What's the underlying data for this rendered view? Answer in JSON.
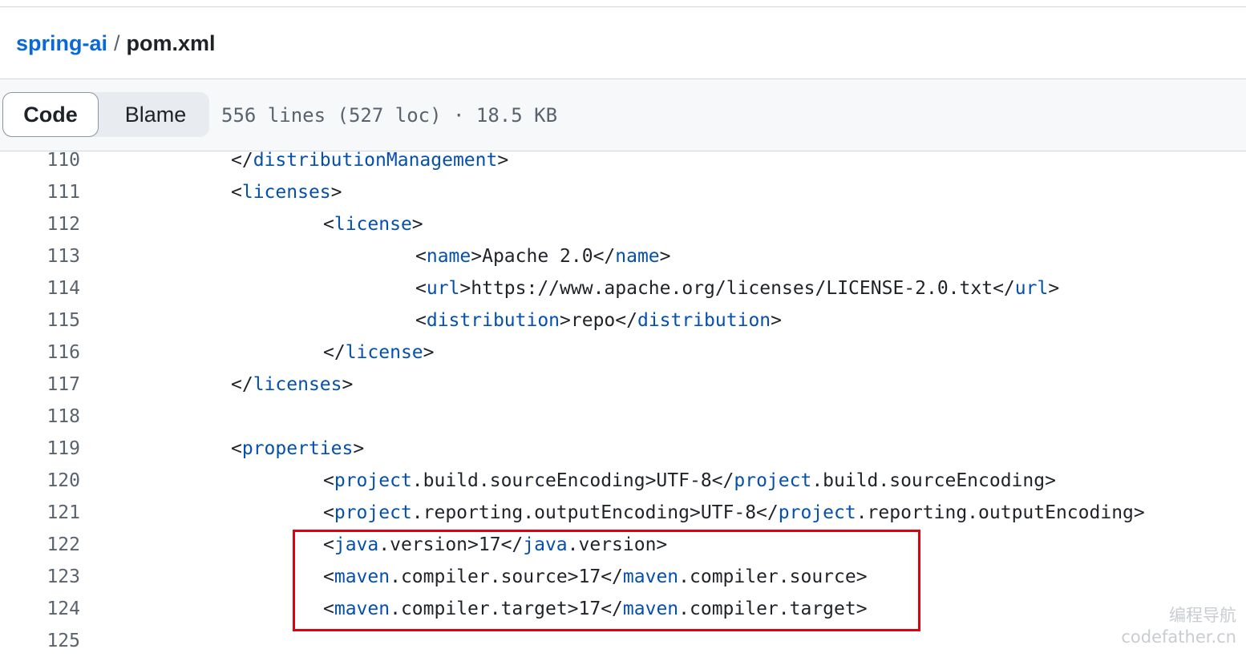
{
  "breadcrumb": {
    "repo": "spring-ai",
    "separator": "/",
    "file": "pom.xml"
  },
  "toolbar": {
    "code_label": "Code",
    "blame_label": "Blame",
    "file_info": "556 lines (527 loc) · 18.5 KB"
  },
  "code": {
    "lines": [
      {
        "num": "110",
        "indent": 0,
        "tokens": [
          {
            "t": "</"
          },
          {
            "t": "distributionManagement",
            "tag": true
          },
          {
            "t": ">"
          }
        ]
      },
      {
        "num": "111",
        "indent": 0,
        "tokens": [
          {
            "t": "<"
          },
          {
            "t": "licenses",
            "tag": true
          },
          {
            "t": ">"
          }
        ]
      },
      {
        "num": "112",
        "indent": 1,
        "tokens": [
          {
            "t": "<"
          },
          {
            "t": "license",
            "tag": true
          },
          {
            "t": ">"
          }
        ]
      },
      {
        "num": "113",
        "indent": 2,
        "tokens": [
          {
            "t": "<"
          },
          {
            "t": "name",
            "tag": true
          },
          {
            "t": ">Apache 2.0</"
          },
          {
            "t": "name",
            "tag": true
          },
          {
            "t": ">"
          }
        ]
      },
      {
        "num": "114",
        "indent": 2,
        "tokens": [
          {
            "t": "<"
          },
          {
            "t": "url",
            "tag": true
          },
          {
            "t": ">https://www.apache.org/licenses/LICENSE-2.0.txt</"
          },
          {
            "t": "url",
            "tag": true
          },
          {
            "t": ">"
          }
        ]
      },
      {
        "num": "115",
        "indent": 2,
        "tokens": [
          {
            "t": "<"
          },
          {
            "t": "distribution",
            "tag": true
          },
          {
            "t": ">repo</"
          },
          {
            "t": "distribution",
            "tag": true
          },
          {
            "t": ">"
          }
        ]
      },
      {
        "num": "116",
        "indent": 1,
        "tokens": [
          {
            "t": "</"
          },
          {
            "t": "license",
            "tag": true
          },
          {
            "t": ">"
          }
        ]
      },
      {
        "num": "117",
        "indent": 0,
        "tokens": [
          {
            "t": "</"
          },
          {
            "t": "licenses",
            "tag": true
          },
          {
            "t": ">"
          }
        ]
      },
      {
        "num": "118",
        "indent": 0,
        "tokens": []
      },
      {
        "num": "119",
        "indent": 0,
        "tokens": [
          {
            "t": "<"
          },
          {
            "t": "properties",
            "tag": true
          },
          {
            "t": ">"
          }
        ]
      },
      {
        "num": "120",
        "indent": 1,
        "tokens": [
          {
            "t": "<"
          },
          {
            "t": "project",
            "tag": true
          },
          {
            "t": ".build.sourceEncoding>UTF-8</"
          },
          {
            "t": "project",
            "tag": true
          },
          {
            "t": ".build.sourceEncoding>"
          }
        ]
      },
      {
        "num": "121",
        "indent": 1,
        "tokens": [
          {
            "t": "<"
          },
          {
            "t": "project",
            "tag": true
          },
          {
            "t": ".reporting.outputEncoding>UTF-8</"
          },
          {
            "t": "project",
            "tag": true
          },
          {
            "t": ".reporting.outputEncoding>"
          }
        ]
      },
      {
        "num": "122",
        "indent": 1,
        "tokens": [
          {
            "t": "<"
          },
          {
            "t": "java",
            "tag": true
          },
          {
            "t": ".version>17</"
          },
          {
            "t": "java",
            "tag": true
          },
          {
            "t": ".version>"
          }
        ]
      },
      {
        "num": "123",
        "indent": 1,
        "tokens": [
          {
            "t": "<"
          },
          {
            "t": "maven",
            "tag": true
          },
          {
            "t": ".compiler.source>17</"
          },
          {
            "t": "maven",
            "tag": true
          },
          {
            "t": ".compiler.source>"
          }
        ]
      },
      {
        "num": "124",
        "indent": 1,
        "tokens": [
          {
            "t": "<"
          },
          {
            "t": "maven",
            "tag": true
          },
          {
            "t": ".compiler.target>17</"
          },
          {
            "t": "maven",
            "tag": true
          },
          {
            "t": ".compiler.target>"
          }
        ]
      },
      {
        "num": "125",
        "indent": 0,
        "tokens": []
      }
    ]
  },
  "watermark": {
    "line1": "编程导航",
    "line2": "codefather.cn"
  },
  "colors": {
    "link": "#0969da",
    "tag": "#0550ae",
    "highlight_border": "#e0000e",
    "line_number": "#59636e"
  }
}
